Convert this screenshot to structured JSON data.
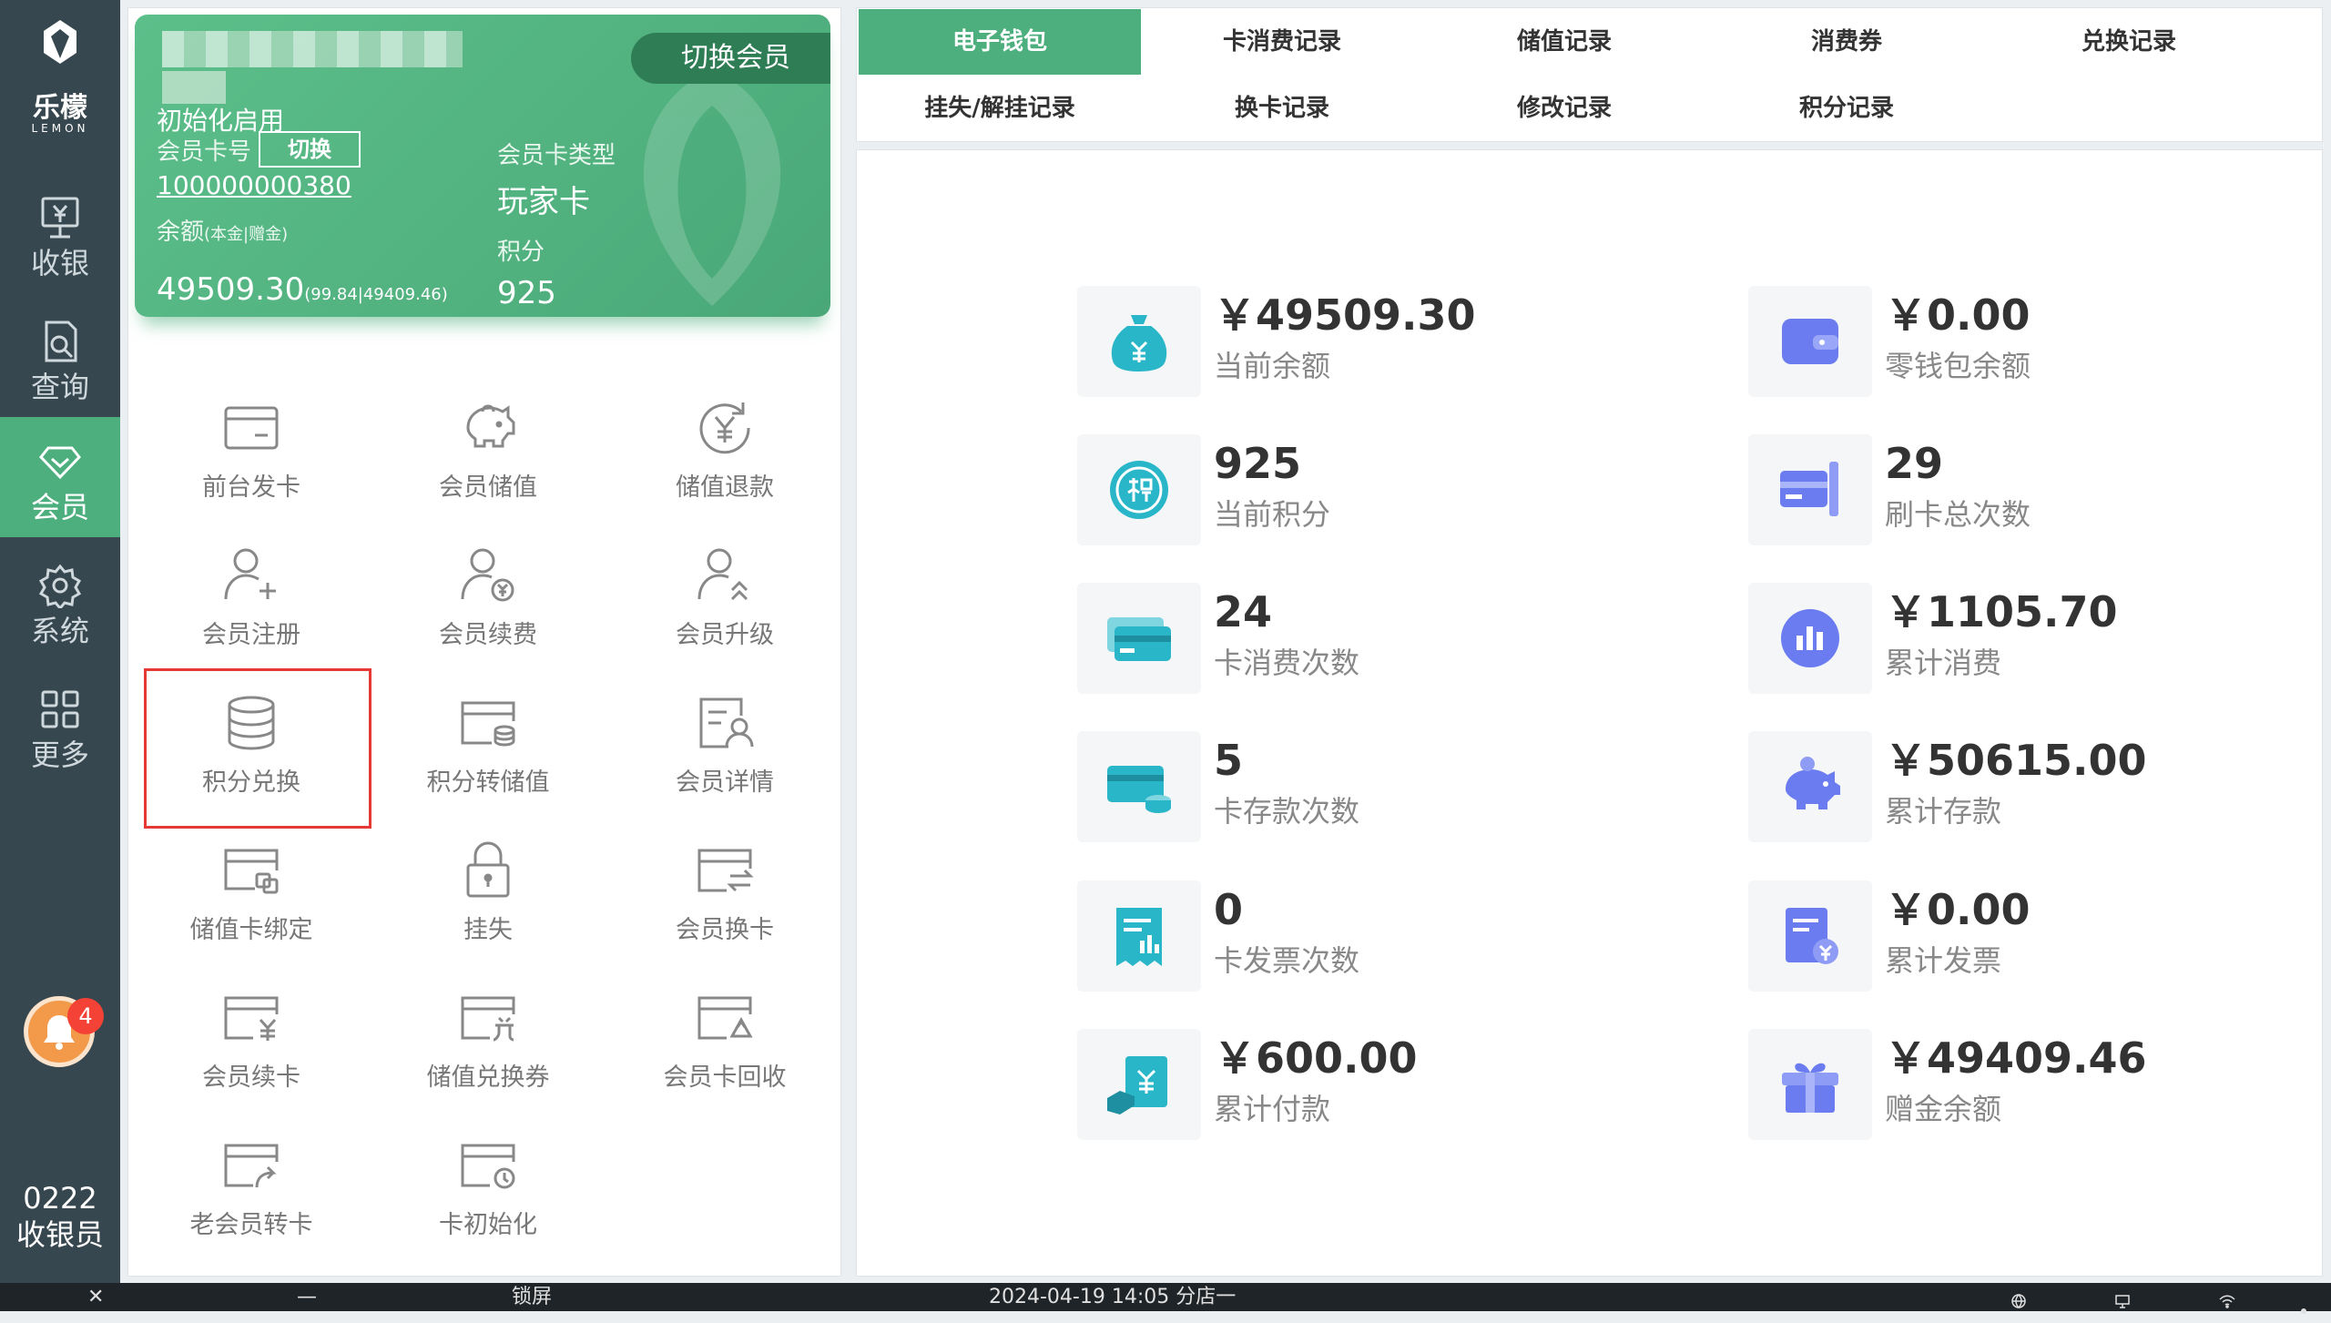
{
  "rail": {
    "brand": "乐檬",
    "brand_en": "LEMON",
    "items": [
      {
        "label": "收银",
        "icon": "cashier-icon"
      },
      {
        "label": "查询",
        "icon": "query-icon"
      },
      {
        "label": "会员",
        "icon": "diamond-icon",
        "active": true
      },
      {
        "label": "系统",
        "icon": "gear-icon"
      },
      {
        "label": "更多",
        "icon": "grid-icon"
      }
    ],
    "notification_count": "4",
    "operator_id": "0222",
    "operator_role": "收银员"
  },
  "card": {
    "switch_member_label": "切换会员",
    "status": "初始化启用",
    "card_no_label": "会员卡号",
    "switch_card_label": "切换",
    "card_no": "100000000380",
    "balance_label": "余额",
    "balance_note": "(本金|赠金)",
    "balance": "49509.30",
    "balance_split": "(99.84|49409.46)",
    "type_label": "会员卡类型",
    "type": "玩家卡",
    "points_label": "积分",
    "points": "925"
  },
  "functions": [
    {
      "label": "前台发卡",
      "icon": "card-icon"
    },
    {
      "label": "会员储值",
      "icon": "piggy-bank-icon"
    },
    {
      "label": "储值退款",
      "icon": "refund-icon"
    },
    {
      "label": "会员注册",
      "icon": "user-add-icon"
    },
    {
      "label": "会员续费",
      "icon": "user-yuan-icon"
    },
    {
      "label": "会员升级",
      "icon": "user-upgrade-icon"
    },
    {
      "label": "积分兑换",
      "icon": "database-icon"
    },
    {
      "label": "积分转储值",
      "icon": "card-coins-icon"
    },
    {
      "label": "会员详情",
      "icon": "user-detail-icon"
    },
    {
      "label": "储值卡绑定",
      "icon": "card-bind-icon"
    },
    {
      "label": "挂失",
      "icon": "lock-icon"
    },
    {
      "label": "会员换卡",
      "icon": "card-swap-icon"
    },
    {
      "label": "会员续卡",
      "icon": "card-yuan-icon"
    },
    {
      "label": "储值兑换券",
      "icon": "card-coupon-icon"
    },
    {
      "label": "会员卡回收",
      "icon": "card-recycle-icon"
    },
    {
      "label": "老会员转卡",
      "icon": "card-transfer-icon"
    },
    {
      "label": "卡初始化",
      "icon": "card-reset-icon"
    }
  ],
  "tabs": [
    {
      "label": "电子钱包",
      "active": true
    },
    {
      "label": "卡消费记录"
    },
    {
      "label": "储值记录"
    },
    {
      "label": "消费券"
    },
    {
      "label": "兑换记录"
    },
    {
      "label": "挂失/解挂记录"
    },
    {
      "label": "换卡记录"
    },
    {
      "label": "修改记录"
    },
    {
      "label": "积分记录"
    }
  ],
  "stats": [
    {
      "value": "￥49509.30",
      "caption": "当前余额",
      "icon": "money-bag-icon",
      "color": "#29b6c8"
    },
    {
      "value": "￥0.00",
      "caption": "零钱包余额",
      "icon": "wallet-icon",
      "color": "#6a7cf0"
    },
    {
      "value": "925",
      "caption": "当前积分",
      "icon": "points-icon",
      "color": "#29b6c8"
    },
    {
      "value": "29",
      "caption": "刷卡总次数",
      "icon": "card-swipe-icon",
      "color": "#6a7cf0"
    },
    {
      "value": "24",
      "caption": "卡消费次数",
      "icon": "cards-icon",
      "color": "#29b6c8"
    },
    {
      "value": "￥1105.70",
      "caption": "累计消费",
      "icon": "bar-chart-icon",
      "color": "#6a7cf0"
    },
    {
      "value": "5",
      "caption": "卡存款次数",
      "icon": "card-deposit-icon",
      "color": "#29b6c8"
    },
    {
      "value": "￥50615.00",
      "caption": "累计存款",
      "icon": "piggy-icon",
      "color": "#6a7cf0"
    },
    {
      "value": "0",
      "caption": "卡发票次数",
      "icon": "receipt-icon",
      "color": "#29b6c8"
    },
    {
      "value": "￥0.00",
      "caption": "累计发票",
      "icon": "invoice-icon",
      "color": "#6a7cf0"
    },
    {
      "value": "￥600.00",
      "caption": "累计付款",
      "icon": "payment-icon",
      "color": "#29b6c8"
    },
    {
      "value": "￥49409.46",
      "caption": "赠金余额",
      "icon": "gift-icon",
      "color": "#6a7cf0"
    }
  ],
  "taskbar": {
    "close_glyph": "✕",
    "minimize_glyph": "—",
    "lock_label": "锁屏",
    "datetime_store": "2024-04-19 14:05 分店一"
  }
}
